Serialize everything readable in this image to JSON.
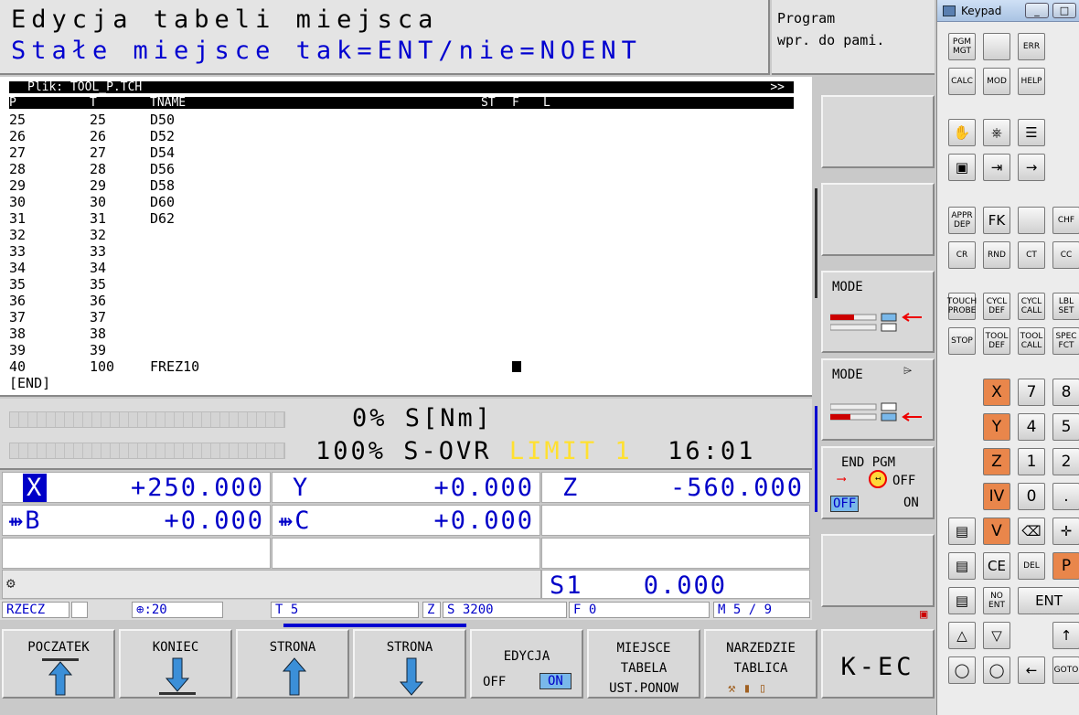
{
  "header": {
    "line1": "Edycja tabeli miejsca",
    "line2": "Stałe miejsce tak=ENT/nie=NOENT",
    "program_label": "Program\nwpr. do pami."
  },
  "table": {
    "file_label": "Plik: TOOL_P.TCH",
    "scroll_marker": ">>",
    "columns": {
      "p": "P",
      "t": "T",
      "tname": "TNAME",
      "st": "ST",
      "f": "F",
      "l": "L"
    },
    "rows": [
      {
        "p": "25",
        "t": "25",
        "tname": "D50"
      },
      {
        "p": "26",
        "t": "26",
        "tname": "D52"
      },
      {
        "p": "27",
        "t": "27",
        "tname": "D54"
      },
      {
        "p": "28",
        "t": "28",
        "tname": "D56"
      },
      {
        "p": "29",
        "t": "29",
        "tname": "D58"
      },
      {
        "p": "30",
        "t": "30",
        "tname": "D60"
      },
      {
        "p": "31",
        "t": "31",
        "tname": "D62"
      },
      {
        "p": "32",
        "t": "32",
        "tname": ""
      },
      {
        "p": "33",
        "t": "33",
        "tname": ""
      },
      {
        "p": "34",
        "t": "34",
        "tname": ""
      },
      {
        "p": "35",
        "t": "35",
        "tname": ""
      },
      {
        "p": "36",
        "t": "36",
        "tname": ""
      },
      {
        "p": "37",
        "t": "37",
        "tname": ""
      },
      {
        "p": "38",
        "t": "38",
        "tname": ""
      },
      {
        "p": "39",
        "t": "39",
        "tname": ""
      },
      {
        "p": "40",
        "t": "100",
        "tname": "FREZ10"
      }
    ],
    "end_label": "[END]"
  },
  "load": {
    "line1": "0% S[Nm]",
    "line2_pre": "100% S-OVR ",
    "limit": "LIMIT 1",
    "time": "16:01"
  },
  "positions": {
    "x_axis": "X",
    "x_val": "+250.000",
    "y_axis": "Y",
    "y_val": "+0.000",
    "z_axis": "Z",
    "z_val": "-560.000",
    "b_axis": "B",
    "b_val": "+0.000",
    "c_axis": "C",
    "c_val": "+0.000",
    "s_label": "S1",
    "s_val": "0.000"
  },
  "status": {
    "mode": "RZECZ",
    "plane": ":20",
    "tool": "T 5",
    "spindle_axis": "Z",
    "speed": "S 3200",
    "feed": "F 0",
    "misc": "M 5 / 9"
  },
  "right_softkeys": {
    "mode1": "MODE",
    "mode2": "MODE",
    "endpgm": "END PGM",
    "off": "OFF",
    "on": "ON"
  },
  "bottom_softkeys": {
    "start": "POCZATEK",
    "end": "KONIEC",
    "page_up": "STRONA",
    "page_down": "STRONA",
    "edit": "EDYCJA",
    "edit_off": "OFF",
    "edit_on": "ON",
    "pocket": "MIEJSCE\nTABELA\nUST.PONOW",
    "tool": "NARZEDZIE\nTABLICA",
    "kec": "K-EC"
  },
  "keypad": {
    "title": "Keypad",
    "keys": [
      "PGM\nMGT",
      "",
      "ERR",
      "CALC",
      "MOD",
      "HELP",
      "APPR\nDEP",
      "FK",
      "",
      "CHF",
      "CR",
      "RND",
      "CT",
      "CC",
      "TOUCH\nPROBE",
      "CYCL\nDEF",
      "CYCL\nCALL",
      "LBL\nSET",
      "STOP",
      "TOOL\nDEF",
      "TOOL\nCALL",
      "SPEC\nFCT",
      "X",
      "7",
      "8",
      "Y",
      "4",
      "5",
      "Z",
      "1",
      "2",
      "IV",
      "0",
      ".",
      "V",
      "CE",
      "DEL",
      "P",
      "NO\nENT",
      "ENT",
      "GOTO"
    ]
  },
  "colors": {
    "blue_text": "#0000c8",
    "limit": "#ffe030",
    "orange_key": "#e9864b"
  }
}
